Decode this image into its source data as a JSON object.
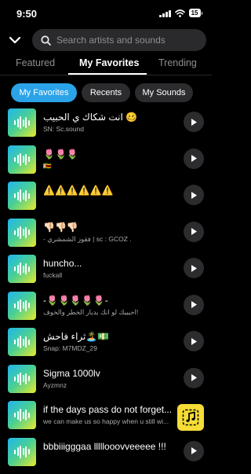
{
  "status_bar": {
    "time": "9:50",
    "battery": "15"
  },
  "search": {
    "placeholder": "Search artists and sounds"
  },
  "tabs": [
    {
      "label": "Featured",
      "active": false
    },
    {
      "label": "My Favorites",
      "active": true
    },
    {
      "label": "Trending",
      "active": false
    }
  ],
  "chips": [
    {
      "label": "My Favorites",
      "active": true
    },
    {
      "label": "Recents",
      "active": false
    },
    {
      "label": "My Sounds",
      "active": false
    }
  ],
  "sounds": [
    {
      "title": "انت شكاك ي الحبيب 🥴",
      "subtitle": "SN: Sc.sound"
    },
    {
      "title": "🌷🌷🌷",
      "subtitle": "🇿🇼"
    },
    {
      "title": "⚠️⚠️⚠️⚠️⚠️⚠️",
      "subtitle": ""
    },
    {
      "title": "👎🏻👎🏻👎🏻",
      "subtitle": "- فقوز الشمشري | sc : GCOZ ."
    },
    {
      "title": "huncho...",
      "subtitle": "fuckall"
    },
    {
      "title": "-🌷🌷🌷🌷🌷-",
      "subtitle": "احبيبك لو انك بديار الخطر والخوف!"
    },
    {
      "title": "ثراء فاحش🏝️💵",
      "subtitle": "Snap: M7MDZ_29"
    },
    {
      "title": "Sigma 1000lv",
      "subtitle": "Ayzmnz"
    },
    {
      "title": "if the days pass do not forget...",
      "subtitle": "we can make us so happy when u still wi..."
    },
    {
      "title": "bbbiiigggaa lllllooovveeeee !!!",
      "subtitle": ""
    }
  ],
  "icons": {
    "back": "chevron-down-icon",
    "search": "search-icon",
    "play": "play-icon",
    "fab": "music-note-icon",
    "thumb": "waveform-icon"
  },
  "colors": {
    "accent": "#2ba3e8",
    "fab": "#f6dc36",
    "thumb_gradient": [
      "#1fb6ef",
      "#4cd090",
      "#e9e92c"
    ]
  }
}
